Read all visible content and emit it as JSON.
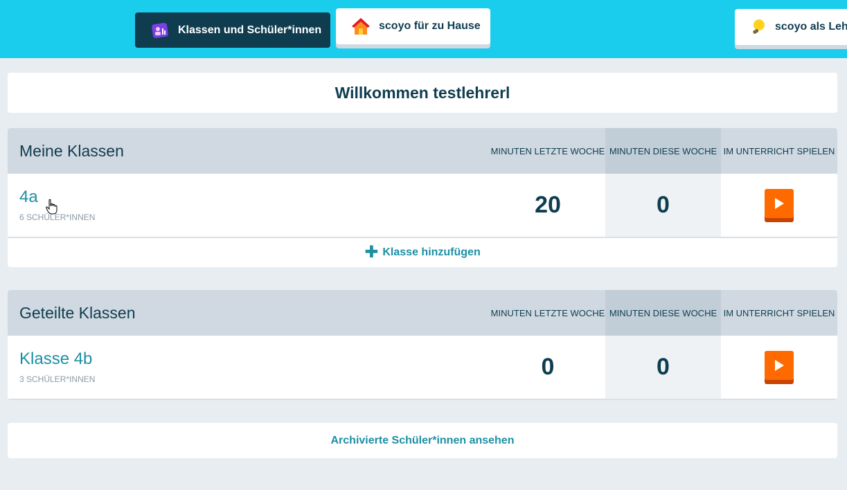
{
  "nav": {
    "tabs": [
      {
        "label": "Klassen und Schüler*innen",
        "icon": "classes-icon",
        "active": true
      },
      {
        "label": "scoyo für zu Hause",
        "icon": "house-icon",
        "active": false
      },
      {
        "label": "scoyo als Lehrkraft",
        "icon": "lightbulb-icon",
        "active": false
      }
    ]
  },
  "welcome": "Willkommen testlehrerl",
  "columns": {
    "last_week": "Minuten letzte Woche",
    "this_week": "Minuten diese Woche",
    "play": "Im Unterricht spielen"
  },
  "my_classes": {
    "title": "Meine Klassen",
    "rows": [
      {
        "name": "4a",
        "students": "6 Schüler*innen",
        "last_week": "20",
        "this_week": "0"
      }
    ],
    "add_label": "Klasse hinzufügen"
  },
  "shared_classes": {
    "title": "Geteilte Klassen",
    "rows": [
      {
        "name": "Klasse 4b",
        "students": "3 Schüler*innen",
        "last_week": "0",
        "this_week": "0"
      }
    ]
  },
  "archive_label": "Archivierte Schüler*innen ansehen",
  "colors": {
    "topbar": "#1bcdec",
    "navy": "#0f3d4f",
    "accent": "#1c8fa5",
    "play": "#ff6a00"
  }
}
